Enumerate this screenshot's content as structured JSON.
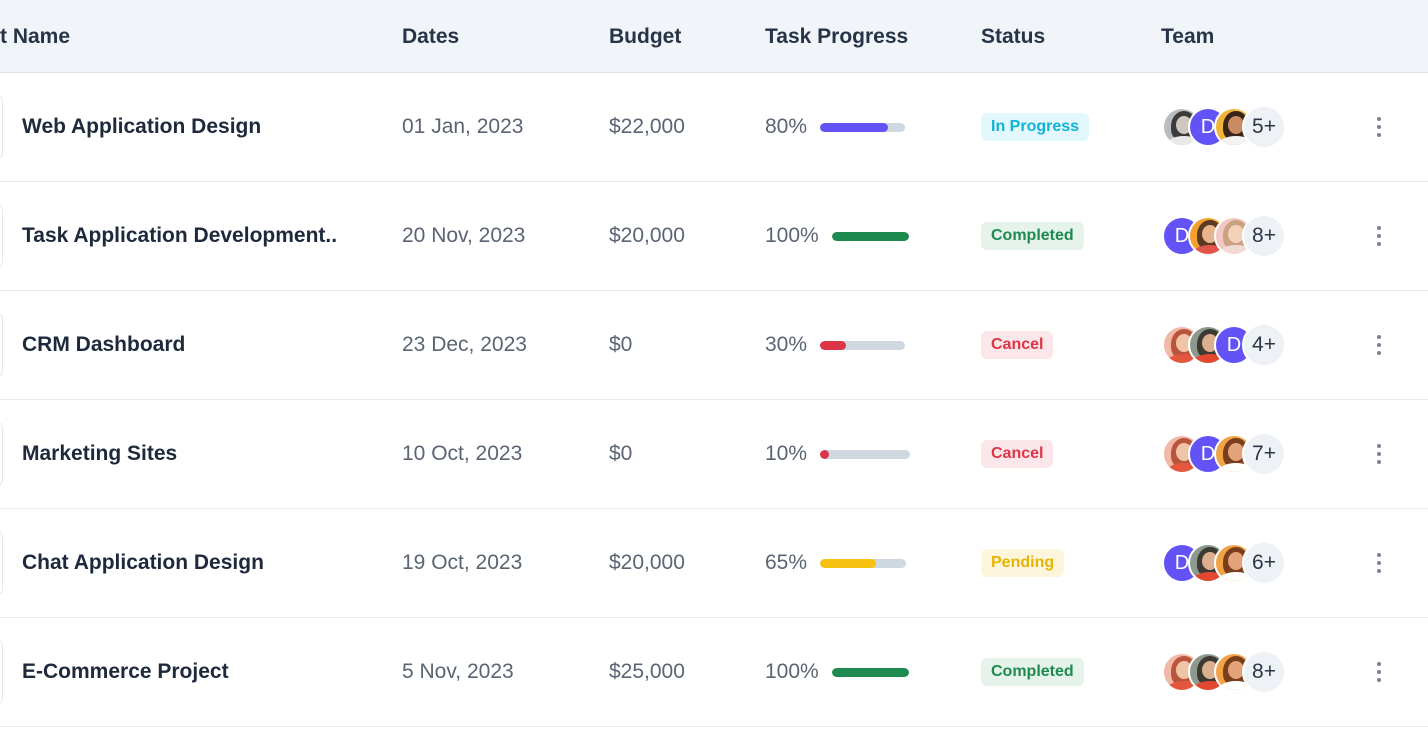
{
  "colors": {
    "accent": "#6352f5",
    "success": "#1f8a50",
    "danger": "#dc3545",
    "warning": "#f7c110",
    "info": "#0dcaf0",
    "track": "#cfd7e1"
  },
  "header": {
    "name": "t Name",
    "dates": "Dates",
    "budget": "Budget",
    "progress": "Task Progress",
    "status": "Status",
    "team": "Team"
  },
  "rows": [
    {
      "name": "Web Application Design",
      "date": "01 Jan, 2023",
      "budget": "$22,000",
      "progress_label": "80%",
      "progress": 0.8,
      "bar_color": "#6352f5",
      "status": "In Progress",
      "status_color": "#10b3d6",
      "status_bg": "#e3f8fc",
      "team": [
        "photo-man-gray",
        "initial-d",
        "photo-woman-dark"
      ],
      "more": "5+"
    },
    {
      "name": "Task Application Development..",
      "date": "20 Nov, 2023",
      "budget": "$20,000",
      "progress_label": "100%",
      "progress": 1.0,
      "bar_color": "#1f8a50",
      "status": "Completed",
      "status_color": "#1f8a50",
      "status_bg": "#e5f3ea",
      "team": [
        "initial-d",
        "photo-man-orange",
        "photo-woman-pink"
      ],
      "more": "8+"
    },
    {
      "name": "CRM Dashboard",
      "date": "23 Dec, 2023",
      "budget": "$0",
      "progress_label": "30%",
      "progress": 0.3,
      "bar_color": "#dc3545",
      "status": "Cancel",
      "status_color": "#dc3545",
      "status_bg": "#fbe7e9",
      "team": [
        "photo-woman-red",
        "photo-man-green",
        "initial-d"
      ],
      "more": "4+"
    },
    {
      "name": "Marketing Sites",
      "date": "10 Oct, 2023",
      "budget": "$0",
      "progress_label": "10%",
      "progress": 0.1,
      "bar_color": "#dc3545",
      "status": "Cancel",
      "status_color": "#dc3545",
      "status_bg": "#fbe7e9",
      "team": [
        "photo-woman-red",
        "initial-d",
        "photo-woman-orange"
      ],
      "more": "7+"
    },
    {
      "name": "Chat Application Design",
      "date": "19 Oct, 2023",
      "budget": "$20,000",
      "progress_label": "65%",
      "progress": 0.65,
      "bar_color": "#f7c110",
      "status": "Pending",
      "status_color": "#e8b400",
      "status_bg": "#fdf6dd",
      "team": [
        "initial-d",
        "photo-man-green",
        "photo-woman-orange"
      ],
      "more": "6+"
    },
    {
      "name": "E-Commerce Project",
      "date": "5 Nov, 2023",
      "budget": "$25,000",
      "progress_label": "100%",
      "progress": 1.0,
      "bar_color": "#1f8a50",
      "status": "Completed",
      "status_color": "#1f8a50",
      "status_bg": "#e5f3ea",
      "team": [
        "photo-woman-red",
        "photo-man-green",
        "photo-woman-orange"
      ],
      "more": "8+"
    }
  ],
  "avatar_initial": "D"
}
